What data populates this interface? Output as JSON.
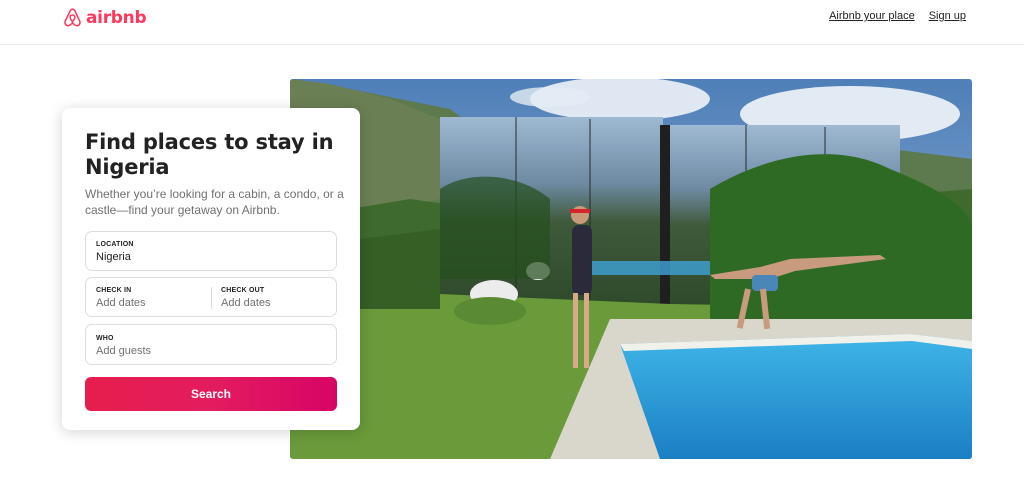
{
  "header": {
    "logo_text": "airbnb",
    "nav": {
      "host_label": "Airbnb your place",
      "signup_label": "Sign up"
    }
  },
  "search_card": {
    "title": "Find places to stay in Nigeria",
    "subtitle": "Whether you’re looking for a cabin, a condo, or a castle—find your getaway on Airbnb.",
    "location": {
      "label": "LOCATION",
      "value": "Nigeria"
    },
    "check_in": {
      "label": "CHECK IN",
      "placeholder": "Add dates"
    },
    "check_out": {
      "label": "CHECK OUT",
      "placeholder": "Add dates"
    },
    "who": {
      "label": "WHO",
      "placeholder": "Add guests"
    },
    "search_label": "Search"
  },
  "colors": {
    "brand": "#ff385c",
    "button_start": "#e61e4d",
    "button_end": "#d70466",
    "text": "#222222",
    "muted": "#717171"
  },
  "hero": {
    "image": "mirrored-glass-house-with-pool-photo"
  }
}
